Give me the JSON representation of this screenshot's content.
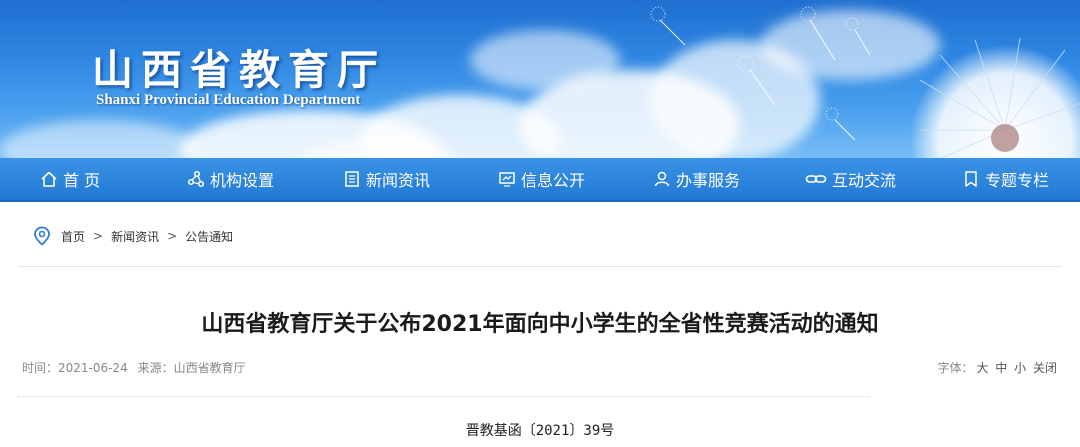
{
  "header": {
    "title_cn": "山西省教育厅",
    "title_en": "Shanxi Provincial Education Department"
  },
  "nav": {
    "items": [
      {
        "label": "首 页",
        "icon": "home-icon"
      },
      {
        "label": "机构设置",
        "icon": "org-icon"
      },
      {
        "label": "新闻资讯",
        "icon": "news-icon"
      },
      {
        "label": "信息公开",
        "icon": "info-icon"
      },
      {
        "label": "办事服务",
        "icon": "service-icon"
      },
      {
        "label": "互动交流",
        "icon": "link-icon"
      },
      {
        "label": "专题专栏",
        "icon": "bookmark-icon"
      }
    ]
  },
  "breadcrumb": {
    "items": [
      "首页",
      "新闻资讯",
      "公告通知"
    ],
    "separator": ">"
  },
  "article": {
    "title": "山西省教育厅关于公布2021年面向中小学生的全省性竞赛活动的通知",
    "time_label": "时间：",
    "time": "2021-06-24",
    "source_label": "来源：",
    "source": "山西省教育厅",
    "font_label": "字体：",
    "font_options": [
      "大",
      "中",
      "小",
      "关闭"
    ],
    "doc_number": "晋教基函〔2021〕39号"
  },
  "colors": {
    "nav_bg": "#2379d3",
    "banner_top": "#1f6fd0",
    "accent": "#2a7fd8"
  }
}
